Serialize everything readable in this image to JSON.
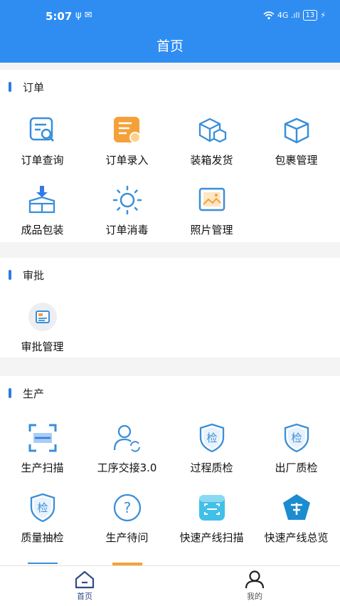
{
  "status": {
    "time": "5:07",
    "left_icons": "ψ ✉",
    "network": "4G .ıll",
    "battery": "13"
  },
  "header": {
    "title": "首页"
  },
  "sections": {
    "orders": {
      "title": "订单",
      "items": [
        {
          "label": "订单查询",
          "icon": "order-search-icon"
        },
        {
          "label": "订单录入",
          "icon": "order-entry-icon"
        },
        {
          "label": "装箱发货",
          "icon": "packing-ship-icon"
        },
        {
          "label": "包裹管理",
          "icon": "package-manage-icon"
        },
        {
          "label": "成品包装",
          "icon": "product-packing-icon"
        },
        {
          "label": "订单消毒",
          "icon": "disinfect-icon"
        },
        {
          "label": "照片管理",
          "icon": "photo-manage-icon"
        }
      ]
    },
    "approval": {
      "title": "审批",
      "items": [
        {
          "label": "审批管理",
          "icon": "approval-manage-icon"
        }
      ]
    },
    "production": {
      "title": "生产",
      "items": [
        {
          "label": "生产扫描",
          "icon": "scan-icon"
        },
        {
          "label": "工序交接3.0",
          "icon": "process-handover-icon"
        },
        {
          "label": "过程质检",
          "icon": "process-inspect-icon"
        },
        {
          "label": "出厂质检",
          "icon": "factory-inspect-icon"
        },
        {
          "label": "质量抽检",
          "icon": "quality-sampling-icon"
        },
        {
          "label": "生产待问",
          "icon": "question-icon"
        },
        {
          "label": "快速产线扫描",
          "icon": "quick-line-scan-icon"
        },
        {
          "label": "快速产线总览",
          "icon": "quick-line-overview-icon"
        }
      ],
      "inspect_glyph": "检",
      "question_glyph": "?"
    }
  },
  "tabs": {
    "home": "首页",
    "mine": "我的"
  },
  "colors": {
    "brand_blue": "#2f8df2",
    "icon_blue": "#3a8fd9",
    "orange": "#f5a13a",
    "cyan": "#41c0e8"
  }
}
